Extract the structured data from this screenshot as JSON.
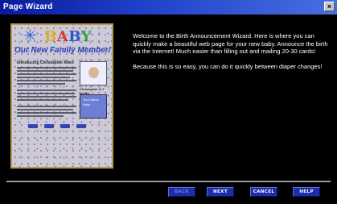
{
  "window": {
    "title": "Page Wizard",
    "close_glyph": "×"
  },
  "preview": {
    "logo_text": "BABY",
    "star_glyph": "✳",
    "headline": "Our New Family Member!",
    "intro": "Introducing Christopher Allen",
    "caption": "Christopher is 7 weeks",
    "box_text": "Your Name Baby",
    "icon": "baby-announcement-page-icon"
  },
  "copy": {
    "paragraph1": "Welcome to the Birth Announcement Wizard.  Here is where you can quickly make a beautiful web page for your new baby.  Announce the birth via the Internet!  Much easier than filling out and mailing 20-30 cards!",
    "paragraph2": "Because this is so easy, you can do it quickly between diaper changes!"
  },
  "buttons": {
    "back": "BACK",
    "next": "NEXT",
    "cancel": "CANCEL",
    "help": "HELP"
  },
  "colors": {
    "title_bar": "#1e3fc8",
    "button": "#1d2ea8",
    "border": "#b89a4a"
  }
}
